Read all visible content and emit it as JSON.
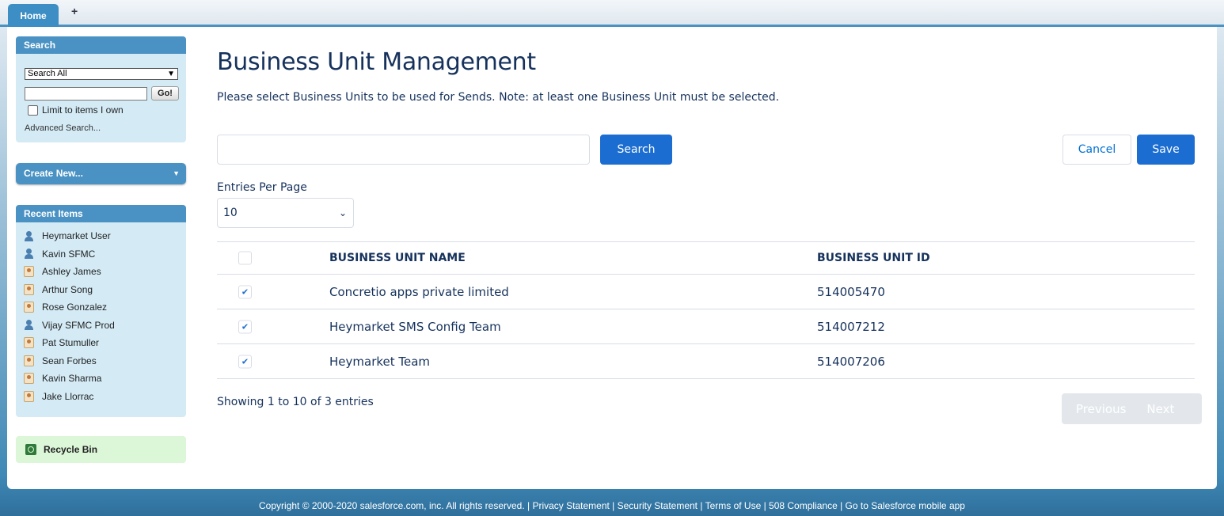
{
  "tabs": {
    "home": "Home",
    "add": "+"
  },
  "sidebar": {
    "search": {
      "header": "Search",
      "scope_value": "Search All",
      "go_label": "Go!",
      "limit_label": "Limit to items I own",
      "advanced_link": "Advanced Search..."
    },
    "create_new": "Create New...",
    "recent": {
      "header": "Recent Items",
      "items": [
        {
          "label": "Heymarket User",
          "icon": "user-icon"
        },
        {
          "label": "Kavin SFMC",
          "icon": "user-icon"
        },
        {
          "label": "Ashley James",
          "icon": "contact-icon"
        },
        {
          "label": "Arthur Song",
          "icon": "contact-icon"
        },
        {
          "label": "Rose Gonzalez",
          "icon": "contact-icon"
        },
        {
          "label": "Vijay SFMC Prod",
          "icon": "user-icon"
        },
        {
          "label": "Pat Stumuller",
          "icon": "contact-icon"
        },
        {
          "label": "Sean Forbes",
          "icon": "contact-icon"
        },
        {
          "label": "Kavin Sharma",
          "icon": "contact-icon"
        },
        {
          "label": "Jake Llorrac",
          "icon": "contact-icon"
        }
      ]
    },
    "recycle_bin": "Recycle Bin"
  },
  "main": {
    "title": "Business Unit Management",
    "subtitle": "Please select Business Units to be used for Sends. Note: at least one Business Unit must be selected.",
    "search_value": "",
    "search_button": "Search",
    "cancel_button": "Cancel",
    "save_button": "Save",
    "entries_label": "Entries Per Page",
    "entries_value": "10",
    "table": {
      "columns": [
        "BUSINESS UNIT NAME",
        "BUSINESS UNIT ID"
      ],
      "rows": [
        {
          "name": "Concretio apps private limited",
          "id": "514005470",
          "checked": true
        },
        {
          "name": "Heymarket SMS Config Team",
          "id": "514007212",
          "checked": true
        },
        {
          "name": "Heymarket Team",
          "id": "514007206",
          "checked": true
        }
      ]
    },
    "showing": "Showing 1 to 10 of 3 entries",
    "previous": "Previous",
    "next": "Next"
  },
  "footer": "Copyright © 2000-2020 salesforce.com, inc. All rights reserved. | Privacy Statement | Security Statement | Terms of Use | 508 Compliance | Go to Salesforce mobile app",
  "colors": {
    "brand": "#1b6dd1",
    "sidebar_header": "#4a92c3",
    "text": "#16325c"
  }
}
